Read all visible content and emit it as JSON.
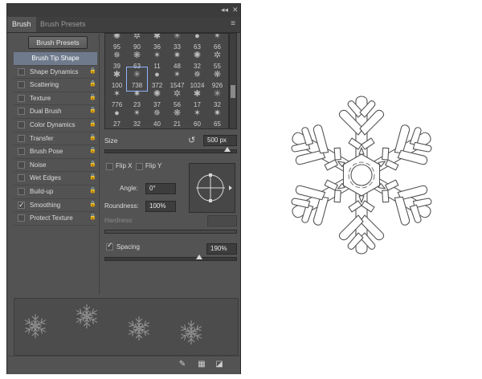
{
  "window": {
    "collapse_icon": "◂◂",
    "close_icon": "✕",
    "menu_icon": "≡"
  },
  "tabs": [
    {
      "label": "Brush",
      "active": true
    },
    {
      "label": "Brush Presets",
      "active": false
    }
  ],
  "brush_presets_button": "Brush Presets",
  "settings": [
    {
      "label": "Brush Tip Shape",
      "selected": true,
      "checkbox": false,
      "checked": false,
      "lock": false
    },
    {
      "label": "Shape Dynamics",
      "selected": false,
      "checkbox": true,
      "checked": false,
      "lock": true
    },
    {
      "label": "Scattering",
      "selected": false,
      "checkbox": true,
      "checked": false,
      "lock": true
    },
    {
      "label": "Texture",
      "selected": false,
      "checkbox": true,
      "checked": false,
      "lock": true
    },
    {
      "label": "Dual Brush",
      "selected": false,
      "checkbox": true,
      "checked": false,
      "lock": true
    },
    {
      "label": "Color Dynamics",
      "selected": false,
      "checkbox": true,
      "checked": false,
      "lock": true
    },
    {
      "label": "Transfer",
      "selected": false,
      "checkbox": true,
      "checked": false,
      "lock": true
    },
    {
      "label": "Brush Pose",
      "selected": false,
      "checkbox": true,
      "checked": false,
      "lock": true
    },
    {
      "label": "Noise",
      "selected": false,
      "checkbox": true,
      "checked": false,
      "lock": true
    },
    {
      "label": "Wet Edges",
      "selected": false,
      "checkbox": true,
      "checked": false,
      "lock": true
    },
    {
      "label": "Build-up",
      "selected": false,
      "checkbox": true,
      "checked": false,
      "lock": true
    },
    {
      "label": "Smoothing",
      "selected": false,
      "checkbox": true,
      "checked": true,
      "lock": true
    },
    {
      "label": "Protect Texture",
      "selected": false,
      "checkbox": true,
      "checked": false,
      "lock": true
    }
  ],
  "brush_grid": {
    "rows": [
      [
        "95",
        "90",
        "36",
        "33",
        "63",
        "66"
      ],
      [
        "39",
        "63",
        "11",
        "48",
        "32",
        "55"
      ],
      [
        "100",
        "738",
        "372",
        "1547",
        "1024",
        "926"
      ],
      [
        "776",
        "23",
        "37",
        "56",
        "17",
        "32"
      ],
      [
        "27",
        "32",
        "40",
        "21",
        "60",
        "65"
      ]
    ],
    "selected": "738"
  },
  "size": {
    "label": "Size",
    "value": "500 px",
    "slider_fraction": 0.93
  },
  "flip_x": {
    "label": "Flip X",
    "checked": false
  },
  "flip_y": {
    "label": "Flip Y",
    "checked": false
  },
  "angle": {
    "label": "Angle:",
    "value": "0°"
  },
  "roundness": {
    "label": "Roundness:",
    "value": "100%"
  },
  "hardness": {
    "label": "Hardness"
  },
  "spacing": {
    "label": "Spacing",
    "checked": true,
    "value": "190%",
    "slider_fraction": 0.72
  },
  "bottom_icons": [
    "create-new-preset-icon",
    "brush-panel-grid-icon",
    "new-brush-icon"
  ],
  "canvas": {
    "subject": "snowflake-brush-tip"
  }
}
